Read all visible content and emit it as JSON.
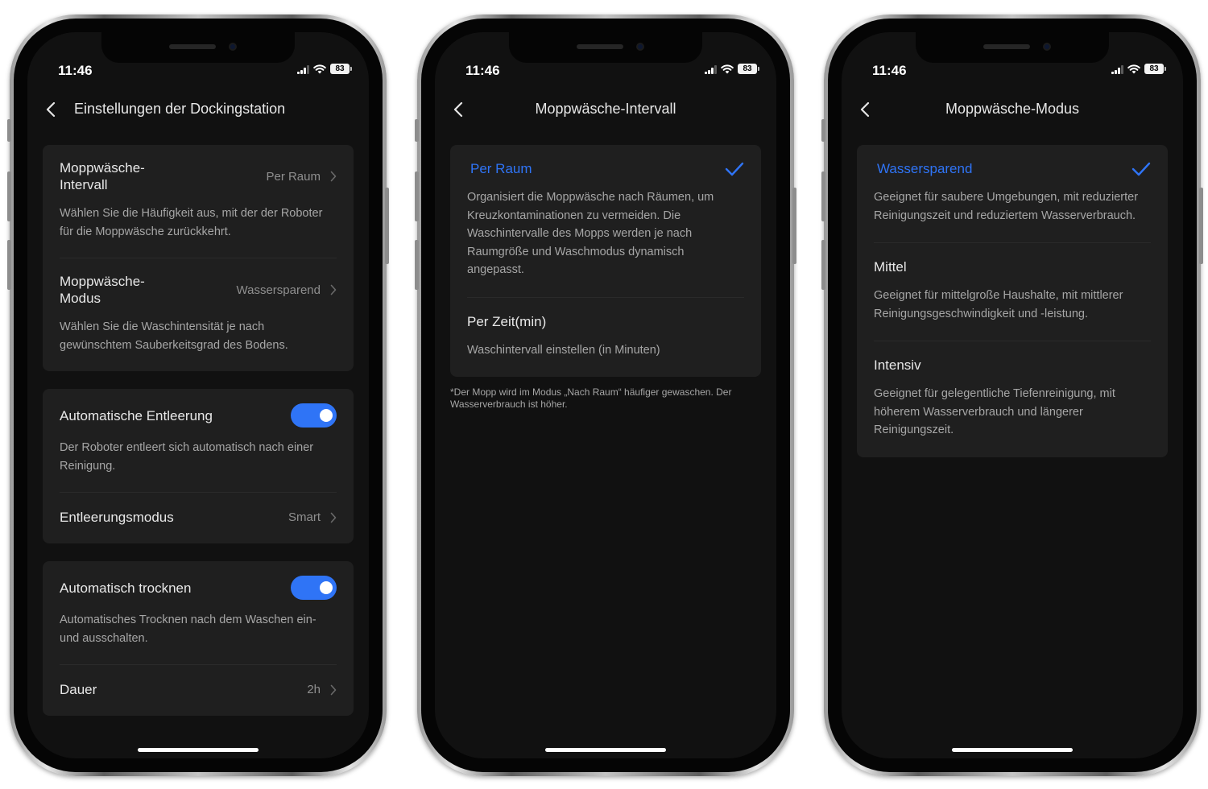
{
  "colors": {
    "accent": "#2f74f6",
    "background": "#111111",
    "card": "#1f1f1f"
  },
  "status_bar": {
    "time": "11:46",
    "battery": "83"
  },
  "screen1": {
    "title": "Einstellungen der Dockingstation",
    "mop_interval": {
      "label": "Moppwäsche-Intervall",
      "value": "Per Raum",
      "description": "Wählen Sie die Häufigkeit aus, mit der der Roboter für die Moppwäsche zurückkehrt."
    },
    "mop_mode": {
      "label": "Moppwäsche-Modus",
      "value": "Wassersparend",
      "description": "Wählen Sie die Waschintensität je nach gewünschtem Sauberkeitsgrad des Bodens."
    },
    "auto_empty": {
      "label": "Automatische Entleerung",
      "enabled": true,
      "description": "Der Roboter entleert sich automatisch nach einer Reinigung."
    },
    "empty_mode": {
      "label": "Entleerungsmodus",
      "value": "Smart"
    },
    "auto_dry": {
      "label": "Automatisch trocknen",
      "enabled": true,
      "description": "Automatisches Trocknen nach dem Waschen ein- und ausschalten."
    },
    "duration": {
      "label": "Dauer",
      "value": "2h"
    }
  },
  "screen2": {
    "title": "Moppwäsche-Intervall",
    "options": [
      {
        "label": "Per Raum",
        "selected": true,
        "description": "Organisiert die Moppwäsche nach Räumen, um Kreuzkontaminationen zu vermeiden. Die Waschintervalle des Mopps werden je nach Raumgröße und Waschmodus dynamisch angepasst."
      },
      {
        "label": "Per Zeit(min)",
        "selected": false,
        "description": "Waschintervall einstellen (in Minuten)"
      }
    ],
    "footnote": "*Der Mopp wird im Modus „Nach Raum“ häufiger gewaschen. Der Wasserverbrauch ist höher."
  },
  "screen3": {
    "title": "Moppwäsche-Modus",
    "options": [
      {
        "label": "Wassersparend",
        "selected": true,
        "description": "Geeignet für saubere Umgebungen, mit reduzierter Reinigungszeit und reduziertem Wasserverbrauch."
      },
      {
        "label": "Mittel",
        "selected": false,
        "description": "Geeignet für mittelgroße Haushalte, mit mittlerer Reinigungsgeschwindigkeit und -leistung."
      },
      {
        "label": "Intensiv",
        "selected": false,
        "description": "Geeignet für gelegentliche Tiefenreinigung, mit höherem Wasserverbrauch und längerer Reinigungszeit."
      }
    ]
  }
}
